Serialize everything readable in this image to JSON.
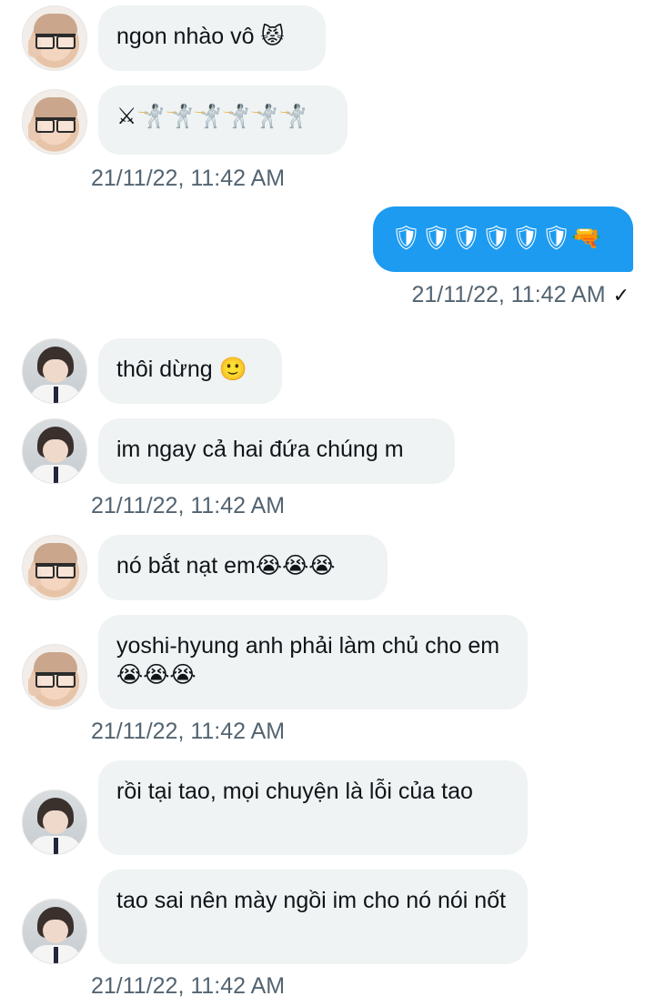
{
  "messages": [
    {
      "text": "ngon nhào vô 😾",
      "avatar": "profile-a"
    },
    {
      "text": "⚔🤺🤺🤺🤺🤺🤺",
      "avatar": "profile-a"
    },
    {
      "timestamp": "21/11/22, 11:42 AM"
    },
    {
      "text": "🛡🛡🛡🛡🛡🛡🔫",
      "outgoing": true
    },
    {
      "timestamp": "21/11/22, 11:42 AM",
      "status": "✓"
    },
    {
      "text": "thôi dừng 🙂",
      "avatar": "profile-b"
    },
    {
      "text": "im ngay cả hai đứa chúng m",
      "avatar": "profile-b"
    },
    {
      "timestamp": "21/11/22, 11:42 AM"
    },
    {
      "text": "nó bắt nạt em😭😭😭",
      "avatar": "profile-a"
    },
    {
      "text": "yoshi-hyung anh phải làm chủ cho em 😭😭😭",
      "avatar": "profile-a"
    },
    {
      "timestamp": "21/11/22, 11:42 AM"
    },
    {
      "text": "rồi tại tao, mọi chuyện là lỗi của tao",
      "avatar": "profile-b"
    },
    {
      "text": "tao sai nên mày ngồi im cho nó nói nốt",
      "avatar": "profile-b"
    },
    {
      "timestamp": "21/11/22, 11:42 AM"
    }
  ],
  "colors": {
    "outgoing_bubble": "#1d9bf0",
    "incoming_bubble": "#eff3f4",
    "timestamp": "#536471"
  }
}
